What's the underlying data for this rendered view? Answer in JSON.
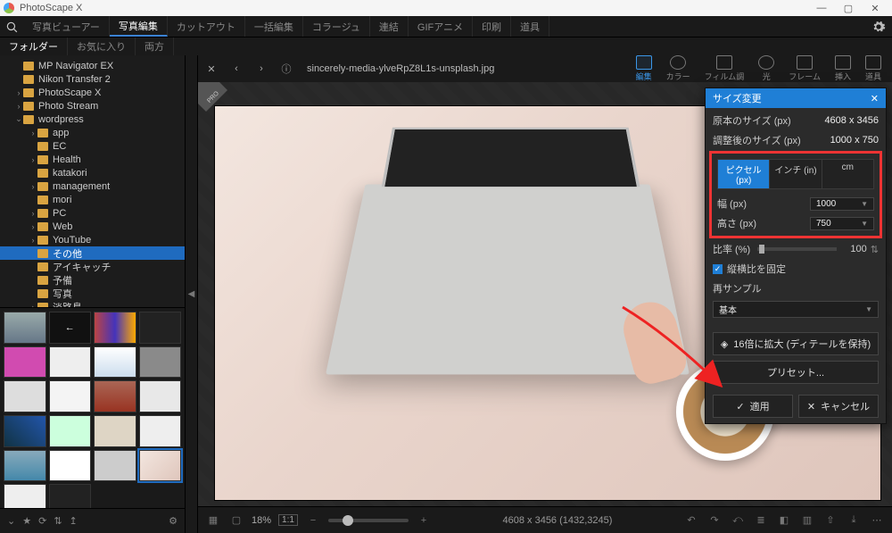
{
  "window": {
    "title": "PhotoScape X",
    "min": "—",
    "max": "▢",
    "close": "✕"
  },
  "main_tabs": [
    "写真ビューアー",
    "写真編集",
    "カットアウト",
    "一括編集",
    "コラージュ",
    "連結",
    "GIFアニメ",
    "印刷",
    "道具"
  ],
  "main_tab_active": 1,
  "sub_tabs": [
    "フォルダー",
    "お気に入り",
    "両方"
  ],
  "sub_tab_active": 0,
  "folders": {
    "level0": [
      "MP Navigator EX",
      "Nikon Transfer 2",
      "PhotoScape X",
      "Photo Stream",
      "wordpress"
    ],
    "wordpress_children": [
      "app",
      "EC",
      "Health",
      "katakori",
      "management",
      "mori",
      "PC",
      "Web",
      "YouTube",
      "その他",
      "アイキャッチ",
      "予備",
      "写真",
      "淡路島"
    ],
    "selected": "その他"
  },
  "canvas": {
    "close": "✕",
    "back": "‹",
    "fwd": "›",
    "info": "ⓘ",
    "filename": "sincerely-media-ylveRpZ8L1s-unsplash.jpg",
    "badge": "PRO",
    "right_tools": [
      {
        "id": "edit",
        "label": "編集"
      },
      {
        "id": "color",
        "label": "カラー"
      },
      {
        "id": "film",
        "label": "フィルム調"
      },
      {
        "id": "light",
        "label": "光"
      },
      {
        "id": "frame",
        "label": "フレーム"
      },
      {
        "id": "insert",
        "label": "挿入"
      },
      {
        "id": "tools",
        "label": "道具"
      }
    ],
    "right_tool_active": 0
  },
  "footer": {
    "zoom_pct": "18%",
    "fit": "1:1",
    "dimensions": "4608 x 3456 (1432,3245)"
  },
  "resize": {
    "title": "サイズ変更",
    "orig_label": "原本のサイズ (px)",
    "orig_value": "4608 x 3456",
    "after_label": "調整後のサイズ (px)",
    "after_value": "1000 x 750",
    "units": [
      "ピクセル (px)",
      "インチ (in)",
      "cm"
    ],
    "unit_active": 0,
    "width_label": "幅 (px)",
    "width_value": "1000",
    "height_label": "高さ (px)",
    "height_value": "750",
    "ratio_label": "比率 (%)",
    "ratio_value": "100",
    "lock_label": "縦横比を固定",
    "lock_checked": true,
    "resample_label": "再サンプル",
    "resample_value": "基本",
    "enlarge_btn": "16倍に拡大 (ディテールを保持)",
    "preset_btn": "プリセット...",
    "apply": "適用",
    "cancel": "キャンセル"
  }
}
